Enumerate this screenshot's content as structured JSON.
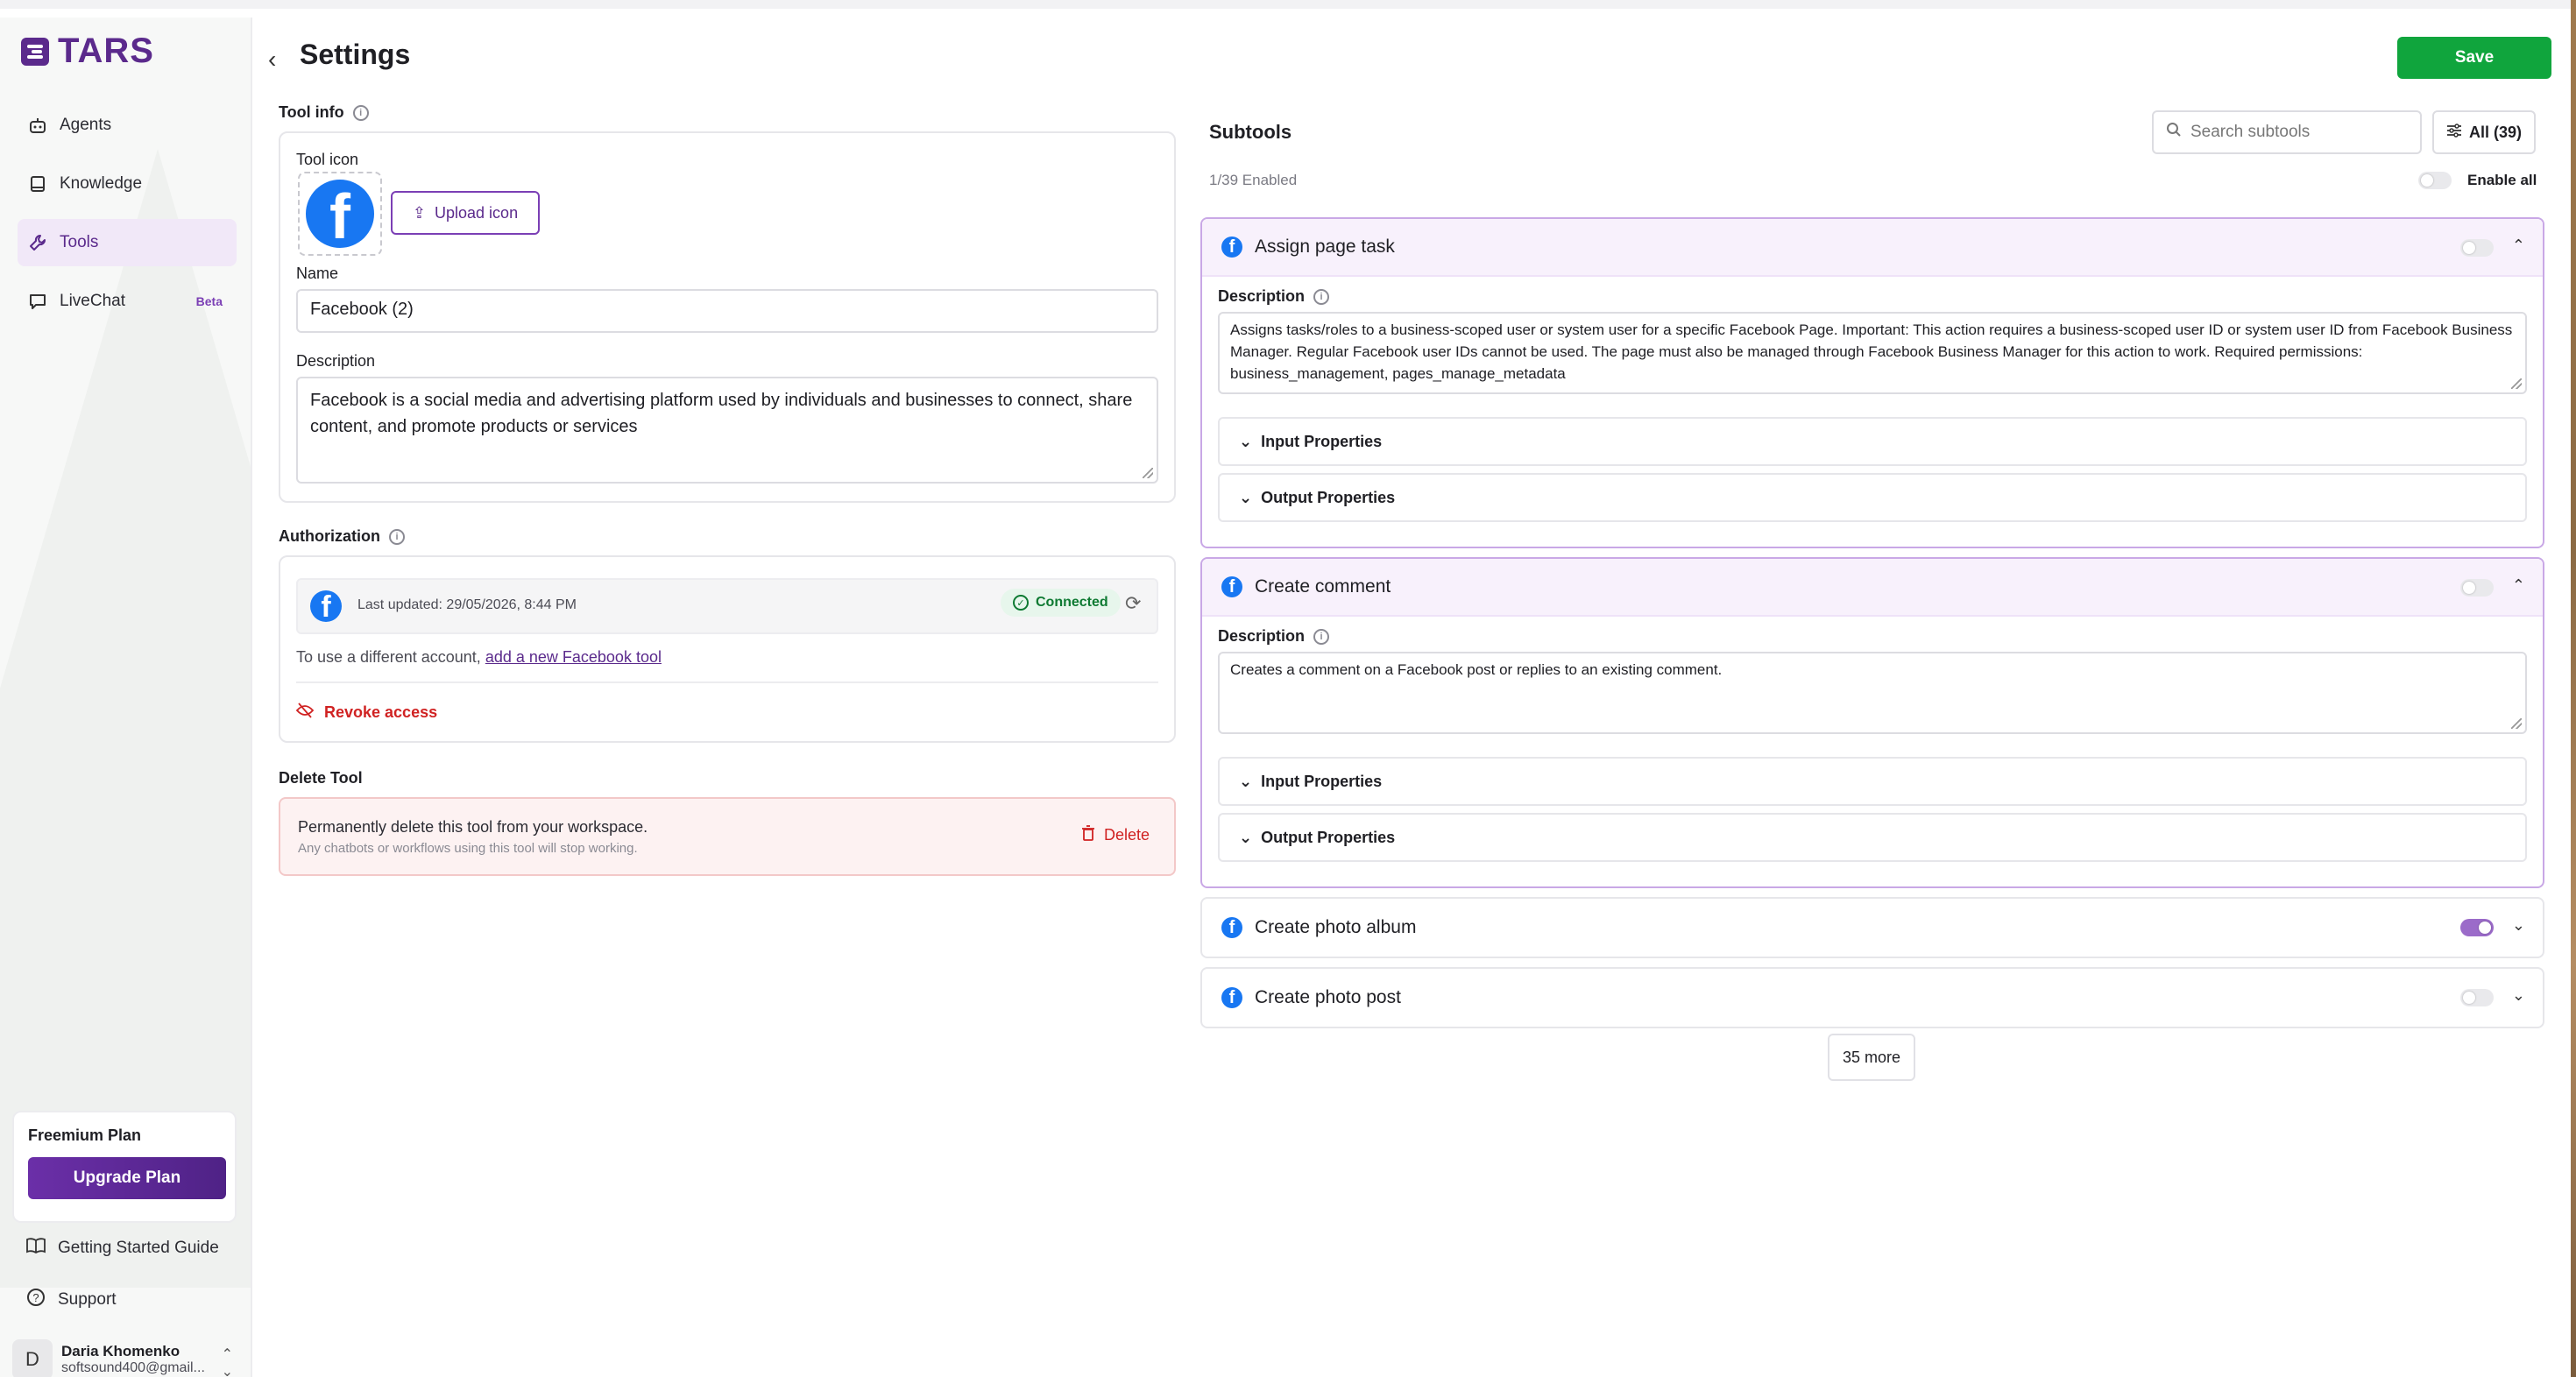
{
  "brand": {
    "name": "TARS",
    "accent": "#5b2a8c",
    "save_color": "#10a53d"
  },
  "sidebar": {
    "items": [
      {
        "label": "Agents",
        "icon": "robot-icon"
      },
      {
        "label": "Knowledge",
        "icon": "book-icon"
      },
      {
        "label": "Tools",
        "icon": "wrench-icon",
        "active": true
      },
      {
        "label": "LiveChat",
        "icon": "chat-icon",
        "badge": "Beta"
      }
    ],
    "plan": {
      "title": "Freemium Plan",
      "button": "Upgrade Plan"
    },
    "guide": "Getting Started Guide",
    "support": "Support",
    "user": {
      "initial": "D",
      "name": "Daria Khomenko",
      "email": "softsound400@gmail..."
    }
  },
  "header": {
    "title": "Settings",
    "save": "Save"
  },
  "tool_info": {
    "section": "Tool info",
    "icon_label": "Tool icon",
    "upload": "Upload icon",
    "name_label": "Name",
    "name_value": "Facebook (2)",
    "desc_label": "Description",
    "desc_value": "Facebook is a social media and advertising platform used by individuals and businesses to connect, share content, and promote products or services"
  },
  "authorization": {
    "section": "Authorization",
    "last_updated": "Last updated: 29/05/2026, 8:44 PM",
    "status": "Connected",
    "hint_prefix": "To use a different account,",
    "hint_link": "add a new Facebook tool",
    "revoke": "Revoke access"
  },
  "delete_tool": {
    "section": "Delete Tool",
    "title": "Permanently delete this tool from your workspace.",
    "subtitle": "Any chatbots or workflows using this tool will stop working.",
    "button": "Delete"
  },
  "subtools": {
    "title": "Subtools",
    "search_placeholder": "Search subtools",
    "filter": "All (39)",
    "enabled_count": "1/39 Enabled",
    "enable_all": "Enable all",
    "desc_label": "Description",
    "input_props": "Input Properties",
    "output_props": "Output Properties",
    "items": [
      {
        "title": "Assign page task",
        "enabled": false,
        "expanded": true,
        "description": "Assigns tasks/roles to a business-scoped user or system user for a specific Facebook Page. Important: This action requires a business-scoped user ID or system user ID from Facebook Business Manager. Regular Facebook user IDs cannot be used. The page must also be managed through Facebook Business Manager for this action to work. Required permissions: business_management, pages_manage_metadata"
      },
      {
        "title": "Create comment",
        "enabled": false,
        "expanded": true,
        "description": "Creates a comment on a Facebook post or replies to an existing comment."
      },
      {
        "title": "Create photo album",
        "enabled": true,
        "expanded": false
      },
      {
        "title": "Create photo post",
        "enabled": false,
        "expanded": false
      }
    ],
    "more": "35 more"
  }
}
